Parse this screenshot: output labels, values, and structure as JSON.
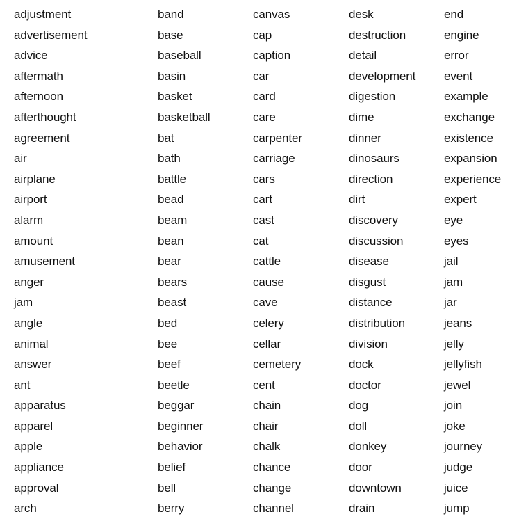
{
  "columns": [
    [
      "adjustment",
      "advertisement",
      "advice",
      "aftermath",
      "afternoon",
      "afterthought",
      "agreement",
      "air",
      "airplane",
      "airport",
      "alarm",
      "amount",
      "amusement",
      "anger",
      "jam",
      "angle",
      "animal",
      "answer",
      "ant",
      "apparatus",
      "apparel",
      "apple",
      "appliance",
      "approval",
      "arch"
    ],
    [
      "band",
      "base",
      "baseball",
      "basin",
      "basket",
      "basketball",
      "bat",
      "bath",
      "battle",
      "bead",
      "beam",
      "bean",
      "bear",
      "bears",
      "beast",
      "bed",
      "bee",
      "beef",
      "beetle",
      "beggar",
      "beginner",
      "behavior",
      "belief",
      "bell",
      "berry"
    ],
    [
      "canvas",
      "cap",
      "caption",
      "car",
      "card",
      "care",
      "carpenter",
      "carriage",
      "cars",
      "cart",
      "cast",
      "cat",
      "cattle",
      "cause",
      "cave",
      "celery",
      "cellar",
      "cemetery",
      "cent",
      "chain",
      "chair",
      "chalk",
      "chance",
      "change",
      "channel"
    ],
    [
      "desk",
      "destruction",
      "detail",
      "development",
      "digestion",
      "dime",
      "dinner",
      "dinosaurs",
      "direction",
      "dirt",
      "discovery",
      "discussion",
      "disease",
      "disgust",
      "distance",
      "distribution",
      "division",
      "dock",
      "doctor",
      "dog",
      "doll",
      "donkey",
      "door",
      "downtown",
      "drain"
    ],
    [
      "end",
      "engine",
      "error",
      "event",
      "example",
      "exchange",
      "existence",
      "expansion",
      "experience",
      "expert",
      "eye",
      "eyes",
      "jail",
      "jam",
      "jar",
      "jeans",
      "jelly",
      "jellyfish",
      "jewel",
      "join",
      "joke",
      "journey",
      "judge",
      "juice",
      "jump"
    ]
  ]
}
